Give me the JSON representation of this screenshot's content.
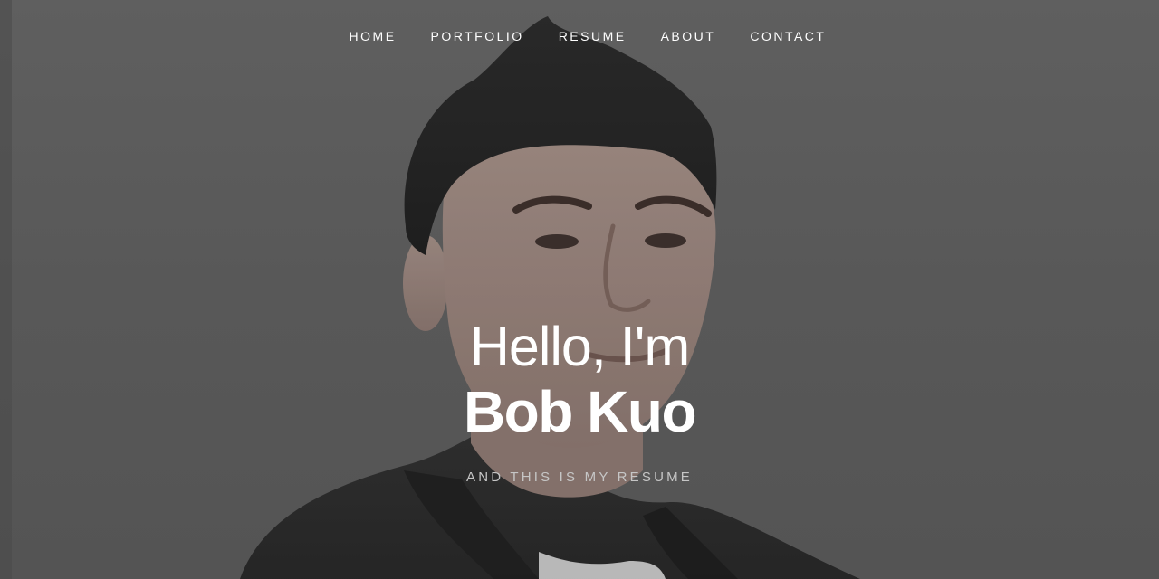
{
  "nav": {
    "items": [
      {
        "label": "HOME"
      },
      {
        "label": "PORTFOLIO"
      },
      {
        "label": "RESUME"
      },
      {
        "label": "ABOUT"
      },
      {
        "label": "CONTACT"
      }
    ]
  },
  "hero": {
    "greeting": "Hello, I'm",
    "name": "Bob Kuo",
    "subtitle": "AND THIS IS MY RESUME",
    "background_color": "#5f5f5f",
    "text_color": "#ffffff"
  }
}
